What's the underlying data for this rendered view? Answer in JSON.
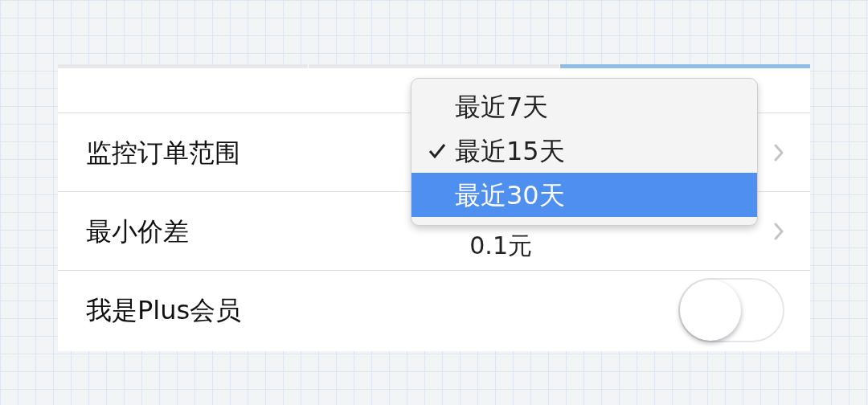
{
  "header_strip": {
    "segments": [
      {
        "selected": false
      },
      {
        "selected": false
      },
      {
        "selected": true
      }
    ]
  },
  "rows": [
    {
      "kind": "menu",
      "label": "监控订单范围"
    },
    {
      "kind": "value",
      "label": "最小价差",
      "value": "0.1元"
    },
    {
      "kind": "toggle",
      "label": "我是Plus会员",
      "on": false
    }
  ],
  "dropdown": {
    "items": [
      {
        "label": "最近7天",
        "checked": false,
        "selected": false
      },
      {
        "label": "最近15天",
        "checked": true,
        "selected": false
      },
      {
        "label": "最近30天",
        "checked": false,
        "selected": true
      }
    ]
  }
}
